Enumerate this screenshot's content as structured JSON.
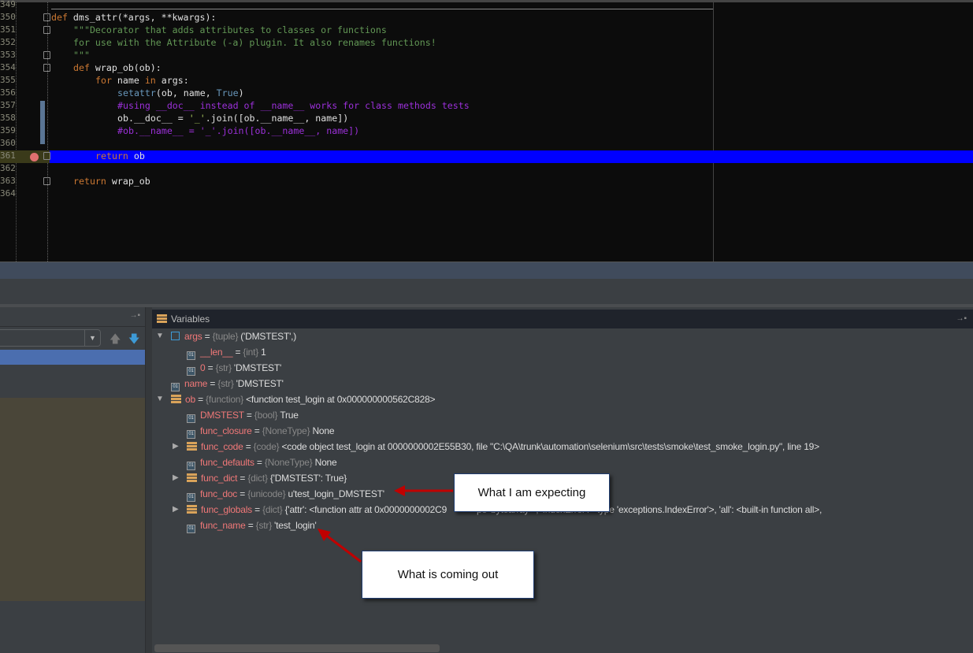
{
  "editor": {
    "line_numbers": [
      "349",
      "350",
      "351",
      "352",
      "353",
      "354",
      "355",
      "356",
      "357",
      "358",
      "359",
      "360",
      "361",
      "362",
      "363",
      "364"
    ],
    "current_line": "361",
    "highlight_color": "#0000ff",
    "lines": [
      {
        "n": "350",
        "indent": 0,
        "parts": [
          [
            "kw",
            "def "
          ],
          [
            "",
            "dms_attr(*args, **kwargs):"
          ]
        ]
      },
      {
        "n": "351",
        "indent": 1,
        "parts": [
          [
            "doc",
            "\"\"\"Decorator that adds attributes to classes or functions"
          ]
        ]
      },
      {
        "n": "352",
        "indent": 1,
        "parts": [
          [
            "doc",
            "for use with the Attribute (-a) plugin. It also renames functions!"
          ]
        ]
      },
      {
        "n": "353",
        "indent": 1,
        "parts": [
          [
            "doc",
            "\"\"\""
          ]
        ]
      },
      {
        "n": "354",
        "indent": 1,
        "parts": [
          [
            "kw",
            "def "
          ],
          [
            "",
            "wrap_ob(ob):"
          ]
        ]
      },
      {
        "n": "355",
        "indent": 2,
        "parts": [
          [
            "kw",
            "for "
          ],
          [
            "",
            "name "
          ],
          [
            "kw",
            "in "
          ],
          [
            "",
            "args:"
          ]
        ]
      },
      {
        "n": "356",
        "indent": 3,
        "parts": [
          [
            "bi",
            "setattr"
          ],
          [
            "",
            "(ob, name, "
          ],
          [
            "bi",
            "True"
          ],
          [
            "",
            ")"
          ]
        ]
      },
      {
        "n": "357",
        "indent": 3,
        "parts": [
          [
            "cm",
            "#using __doc__ instead of __name__ works for class methods tests"
          ]
        ]
      },
      {
        "n": "358",
        "indent": 3,
        "parts": [
          [
            "",
            "ob.__doc__ = "
          ],
          [
            "str",
            "'_'"
          ],
          [
            "",
            ".join([ob.__name__, name])"
          ]
        ]
      },
      {
        "n": "359",
        "indent": 3,
        "parts": [
          [
            "cm",
            "#ob.__name__ = '_'.join([ob.__name__, name])"
          ]
        ]
      },
      {
        "n": "361",
        "indent": 2,
        "parts": [
          [
            "kw",
            "return "
          ],
          [
            "",
            "ob"
          ]
        ]
      },
      {
        "n": "363",
        "indent": 1,
        "parts": [
          [
            "kw",
            "return "
          ],
          [
            "",
            "wrap_ob"
          ]
        ]
      }
    ]
  },
  "variables": {
    "title": "Variables",
    "rows": [
      {
        "depth": 0,
        "expander": "expanded",
        "icon": "list",
        "name": "args",
        "type": "{tuple}",
        "value": "('DMSTEST',)"
      },
      {
        "depth": 1,
        "expander": "",
        "icon": "field",
        "name": "__len__",
        "type": "{int}",
        "value": "1"
      },
      {
        "depth": 1,
        "expander": "",
        "icon": "field",
        "name": "0",
        "type": "{str}",
        "value": "'DMSTEST'"
      },
      {
        "depth": 0,
        "expander": "",
        "icon": "field",
        "name": "name",
        "type": "{str}",
        "value": "'DMSTEST'"
      },
      {
        "depth": 0,
        "expander": "expanded",
        "icon": "struct",
        "name": "ob",
        "type": "{function}",
        "value": "<function test_login at 0x000000000562C828>"
      },
      {
        "depth": 1,
        "expander": "",
        "icon": "field",
        "name": "DMSTEST",
        "type": "{bool}",
        "value": "True"
      },
      {
        "depth": 1,
        "expander": "",
        "icon": "field",
        "name": "func_closure",
        "type": "{NoneType}",
        "value": "None"
      },
      {
        "depth": 1,
        "expander": "collapsed",
        "icon": "struct",
        "name": "func_code",
        "type": "{code}",
        "value": "<code object test_login at 0000000002E55B30, file \"C:\\QA\\trunk\\automation\\selenium\\src\\tests\\smoke\\test_smoke_login.py\", line 19>"
      },
      {
        "depth": 1,
        "expander": "",
        "icon": "field",
        "name": "func_defaults",
        "type": "{NoneType}",
        "value": "None"
      },
      {
        "depth": 1,
        "expander": "collapsed",
        "icon": "struct",
        "name": "func_dict",
        "type": "{dict}",
        "value": "{'DMSTEST': True}"
      },
      {
        "depth": 1,
        "expander": "",
        "icon": "field",
        "name": "func_doc",
        "type": "{unicode}",
        "value": "u'test_login_DMSTEST'"
      },
      {
        "depth": 1,
        "expander": "collapsed",
        "icon": "struct",
        "name": "func_globals",
        "type": "{dict}",
        "value": "{'attr': <function attr at 0x0000000002C9"
      },
      {
        "depth": 1,
        "expander": "",
        "icon": "field",
        "name": "func_name",
        "type": "{str}",
        "value": "'test_login'"
      }
    ],
    "func_globals_tail": "pe 'bytearray'>, 'IndexError': <type 'exceptions.IndexError'>, 'all': <built-in function all>,"
  },
  "callouts": {
    "expecting": "What I am expecting",
    "coming_out": "What is coming out"
  },
  "colors": {
    "arrow": "#c00000",
    "selection": "#4b6eaf"
  }
}
